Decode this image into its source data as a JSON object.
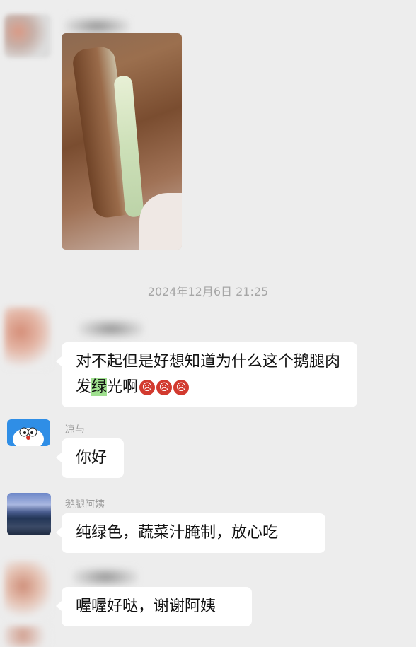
{
  "chat": {
    "timestamp": "2024年12月6日 21:25",
    "messages": [
      {
        "sender": "",
        "text_before": "对不起但是好想知道为什么这个鹅腿肉发",
        "highlight": "绿",
        "text_after": "光啊"
      },
      {
        "sender": "凉与",
        "text": "你好"
      },
      {
        "sender": "鹅腿阿姨",
        "text": "纯绿色，蔬菜汁腌制，放心吃"
      },
      {
        "sender": "",
        "text": "喔喔好哒，谢谢阿姨"
      }
    ],
    "emoji_icon": "penguin-face-emoji"
  }
}
